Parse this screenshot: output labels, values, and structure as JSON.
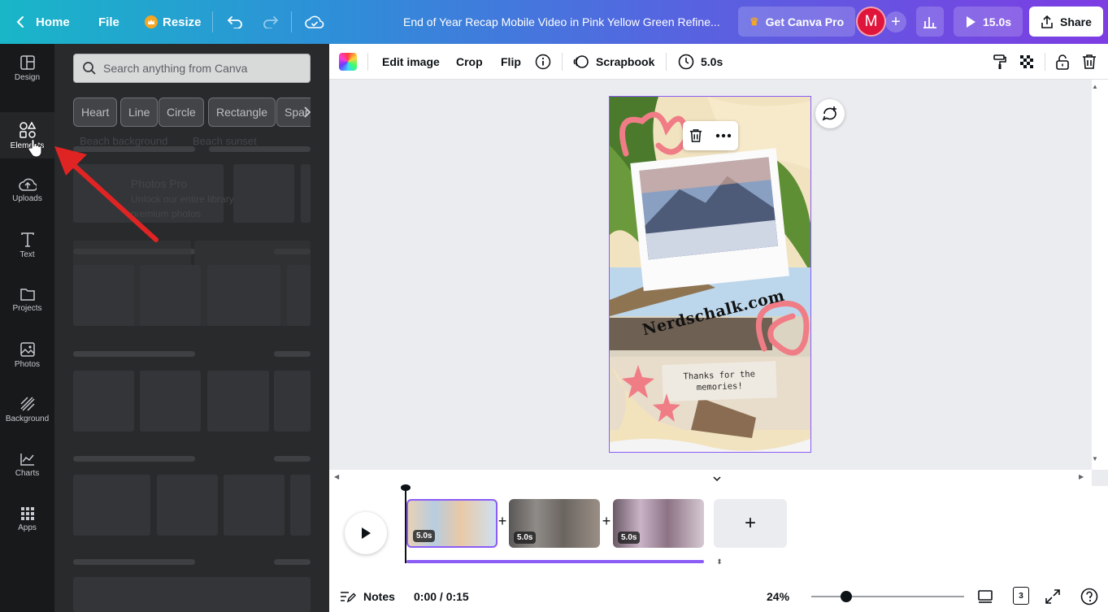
{
  "header": {
    "home_label": "Home",
    "file_label": "File",
    "resize_label": "Resize",
    "document_title": "End of Year Recap Mobile Video in Pink Yellow Green Refine...",
    "get_pro_label": "Get Canva Pro",
    "avatar_initial": "M",
    "play_duration": "15.0s",
    "share_label": "Share"
  },
  "rail": {
    "items": [
      {
        "label": "Design",
        "icon": "design-icon"
      },
      {
        "label": "Elements",
        "icon": "elements-icon"
      },
      {
        "label": "Uploads",
        "icon": "uploads-icon"
      },
      {
        "label": "Text",
        "icon": "text-icon"
      },
      {
        "label": "Projects",
        "icon": "projects-icon"
      },
      {
        "label": "Photos",
        "icon": "photos-icon"
      },
      {
        "label": "Background",
        "icon": "background-icon"
      },
      {
        "label": "Charts",
        "icon": "charts-icon"
      },
      {
        "label": "Apps",
        "icon": "apps-icon"
      }
    ]
  },
  "panel": {
    "search_placeholder": "Search anything from Canva",
    "chips": [
      "Heart",
      "Line",
      "Circle",
      "Rectangle",
      "Spar"
    ],
    "ghost_texts": [
      "Beach background",
      "Beach sunset",
      "Photos Pro",
      "Unlock our entire library of",
      "premium photos"
    ]
  },
  "toolbar": {
    "edit_image": "Edit image",
    "crop": "Crop",
    "flip": "Flip",
    "scrapbook": "Scrapbook",
    "duration": "5.0s"
  },
  "design": {
    "watermark": "Nerdschalk.com",
    "note_text": "Thanks for the memories!"
  },
  "timeline": {
    "clips": [
      {
        "duration": "5.0s"
      },
      {
        "duration": "5.0s"
      },
      {
        "duration": "5.0s"
      }
    ]
  },
  "footer": {
    "notes_label": "Notes",
    "time_display": "0:00 / 0:15",
    "zoom": "24%",
    "page_count": "3"
  },
  "colors": {
    "accent_purple": "#8b5cf6",
    "pro_crown": "#f5a623",
    "avatar_red": "#e0153b",
    "annotation_arrow": "#e02424"
  },
  "zoom_level": 0.24
}
